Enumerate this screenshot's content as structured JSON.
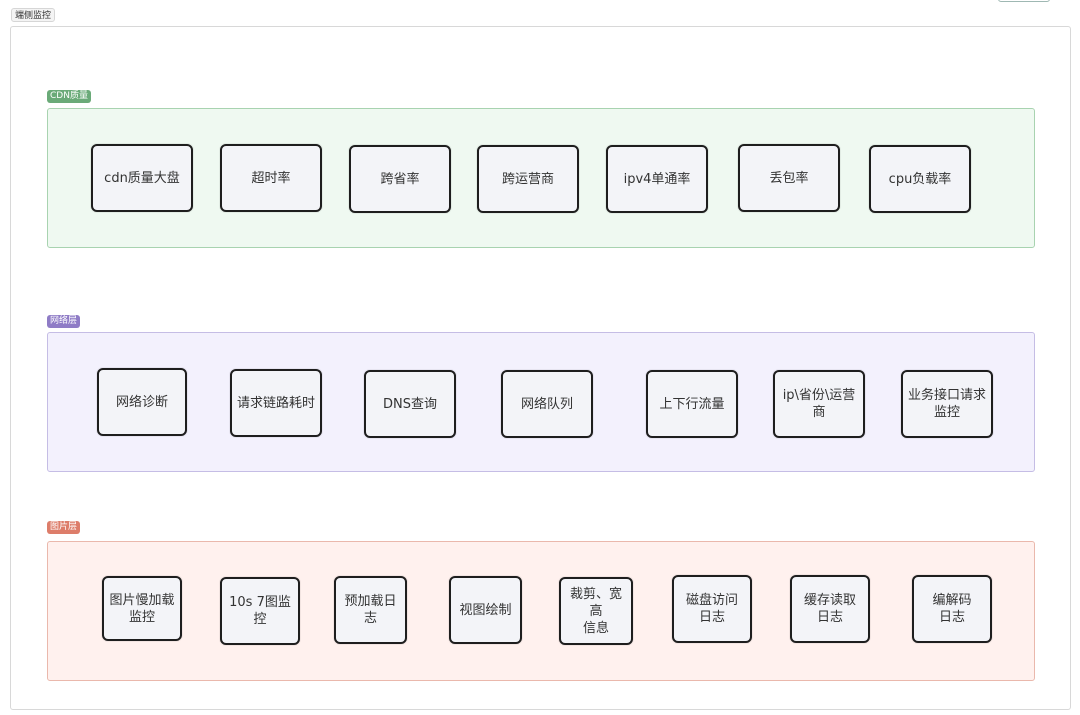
{
  "title": "端侧监控",
  "sections": [
    {
      "label": "CDN质量",
      "color": "#6aaa78",
      "nodes": [
        "cdn质量大盘",
        "超时率",
        "跨省率",
        "跨运营商",
        "ipv4单通率",
        "丢包率",
        "cpu负载率"
      ]
    },
    {
      "label": "网络层",
      "color": "#8f7cc6",
      "nodes": [
        "网络诊断",
        "请求链路耗时",
        "DNS查询",
        "网络队列",
        "上下行流量",
        "ip\\省份\\运营商",
        "业务接口请求\n监控"
      ]
    },
    {
      "label": "图片层",
      "color": "#dd7d6a",
      "nodes": [
        "图片慢加载\n监控",
        "10s 7图监控",
        "预加载日志",
        "视图绘制",
        "裁剪、宽高\n信息",
        "磁盘访问\n日志",
        "缓存读取\n日志",
        "编解码\n日志"
      ]
    }
  ]
}
